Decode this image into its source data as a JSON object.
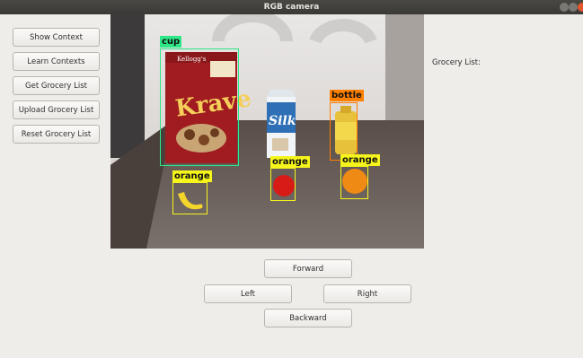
{
  "window": {
    "title": "RGB camera"
  },
  "sidebar": {
    "buttons": [
      {
        "label": "Show Context"
      },
      {
        "label": "Learn Contexts"
      },
      {
        "label": "Get Grocery List"
      },
      {
        "label": "Upload Grocery List"
      },
      {
        "label": "Reset Grocery List"
      }
    ]
  },
  "camera": {
    "box_label": "Kellogg's",
    "detections": [
      {
        "label": "cup",
        "color": "#2ee887"
      },
      {
        "label": "bottle",
        "color": "#ff7f00"
      },
      {
        "label": "orange",
        "color": "#f5f51b"
      },
      {
        "label": "orange",
        "color": "#f5f51b"
      },
      {
        "label": "orange",
        "color": "#f5f51b"
      }
    ],
    "product_texts": {
      "cereal": "Krave",
      "milk": "Silk"
    }
  },
  "grocery_list": {
    "label": "Grocery List:"
  },
  "controls": {
    "forward": "Forward",
    "left": "Left",
    "right": "Right",
    "backward": "Backward"
  }
}
